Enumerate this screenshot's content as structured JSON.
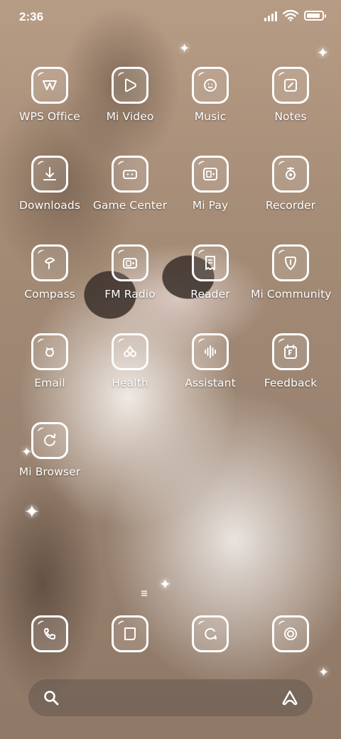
{
  "status_bar": {
    "time": "2:36",
    "icons": [
      "signal-icon",
      "wifi-icon",
      "battery-icon"
    ]
  },
  "apps": [
    {
      "label": "WPS Office",
      "icon": "wps-office-icon"
    },
    {
      "label": "Mi Video",
      "icon": "mi-video-icon"
    },
    {
      "label": "Music",
      "icon": "music-icon"
    },
    {
      "label": "Notes",
      "icon": "notes-icon"
    },
    {
      "label": "Downloads",
      "icon": "downloads-icon"
    },
    {
      "label": "Game Center",
      "icon": "game-center-icon"
    },
    {
      "label": "Mi Pay",
      "icon": "mi-pay-icon"
    },
    {
      "label": "Recorder",
      "icon": "recorder-icon"
    },
    {
      "label": "Compass",
      "icon": "compass-icon"
    },
    {
      "label": "FM Radio",
      "icon": "fm-radio-icon"
    },
    {
      "label": "Reader",
      "icon": "reader-icon"
    },
    {
      "label": "Mi Community",
      "icon": "mi-community-icon"
    },
    {
      "label": "Email",
      "icon": "email-icon"
    },
    {
      "label": "Health",
      "icon": "health-icon"
    },
    {
      "label": "Assistant",
      "icon": "assistant-icon"
    },
    {
      "label": "Feedback",
      "icon": "feedback-icon"
    },
    {
      "label": "Mi Browser",
      "icon": "mi-browser-icon"
    }
  ],
  "dock": [
    {
      "icon": "phone-icon"
    },
    {
      "icon": "messages-icon"
    },
    {
      "icon": "chat-icon"
    },
    {
      "icon": "camera-icon"
    }
  ],
  "search_bar": {
    "left_icon": "search-icon",
    "right_icon": "ai-assistant-icon"
  }
}
